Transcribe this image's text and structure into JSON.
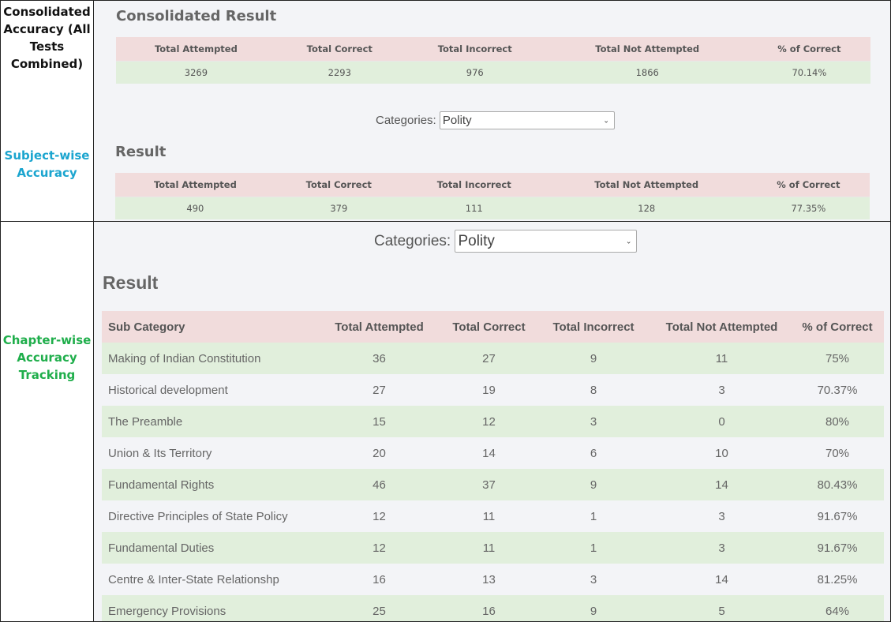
{
  "labels": {
    "consolidated": "Consolidated Accuracy (All Tests Combined)",
    "subject": "Subject-wise Accuracy",
    "chapter": "Chapter-wise Accuracy Tracking"
  },
  "colors": {
    "consolidated": "#111111",
    "subject": "#1ba5cf",
    "chapter": "#1fae4b"
  },
  "consolidated": {
    "title": "Consolidated Result",
    "headers": [
      "Total Attempted",
      "Total Correct",
      "Total Incorrect",
      "Total Not Attempted",
      "% of Correct"
    ],
    "values": [
      "3269",
      "2293",
      "976",
      "1866",
      "70.14%"
    ]
  },
  "subject": {
    "categories_label": "Categories:",
    "selected": "Polity",
    "title": "Result",
    "headers": [
      "Total Attempted",
      "Total Correct",
      "Total Incorrect",
      "Total Not Attempted",
      "% of Correct"
    ],
    "values": [
      "490",
      "379",
      "111",
      "128",
      "77.35%"
    ]
  },
  "chapter": {
    "categories_label": "Categories:",
    "selected": "Polity",
    "title": "Result",
    "headers": [
      "Sub Category",
      "Total Attempted",
      "Total Correct",
      "Total Incorrect",
      "Total Not Attempted",
      "% of Correct"
    ],
    "rows": [
      [
        "Making of Indian Constitution",
        "36",
        "27",
        "9",
        "11",
        "75%"
      ],
      [
        "Historical development",
        "27",
        "19",
        "8",
        "3",
        "70.37%"
      ],
      [
        "The Preamble",
        "15",
        "12",
        "3",
        "0",
        "80%"
      ],
      [
        "Union & Its Territory",
        "20",
        "14",
        "6",
        "10",
        "70%"
      ],
      [
        "Fundamental Rights",
        "46",
        "37",
        "9",
        "14",
        "80.43%"
      ],
      [
        "Directive Principles of State Policy",
        "12",
        "11",
        "1",
        "3",
        "91.67%"
      ],
      [
        "Fundamental Duties",
        "12",
        "11",
        "1",
        "3",
        "91.67%"
      ],
      [
        "Centre & Inter-State Relationshp",
        "16",
        "13",
        "3",
        "14",
        "81.25%"
      ],
      [
        "Emergency Provisions",
        "25",
        "16",
        "9",
        "5",
        "64%"
      ]
    ]
  }
}
